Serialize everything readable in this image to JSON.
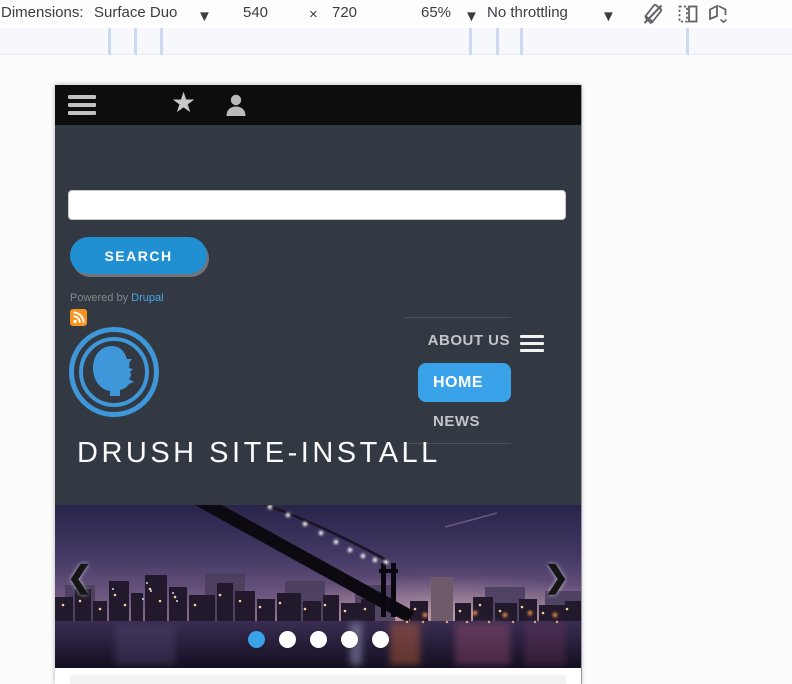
{
  "devtools_toolbar": {
    "dimensions_label": "Dimensions:",
    "device_name": "Surface Duo",
    "width_value": "540",
    "multiply_sign": "×",
    "height_value": "720",
    "zoom_value": "65%",
    "throttling_value": "No throttling",
    "caret": "▼",
    "icons": [
      "rotate-disabled",
      "dual-screen",
      "device-posture"
    ]
  },
  "admin_toolbar": {
    "icons": [
      "menu",
      "shortcuts-star",
      "user",
      "edit-pencil"
    ]
  },
  "search": {
    "value": "",
    "button_label": "SEARCH"
  },
  "branding": {
    "powered_prefix": "Powered by ",
    "powered_link": "Drupal",
    "site_name": "DRUSH SITE-INSTALL"
  },
  "nav": {
    "items": [
      {
        "label": "ABOUT US"
      },
      {
        "label": "HOME"
      },
      {
        "label": "NEWS"
      }
    ],
    "active_index": 1
  },
  "carousel": {
    "prev_arrow": "❮",
    "next_arrow": "❯",
    "dot_count": 5,
    "active_dot_index": 0
  },
  "colors": {
    "accent_blue": "#3aa2e8",
    "button_blue": "#2090d2",
    "link_blue": "#47aae2",
    "rss_orange": "#f8941d",
    "body_dark": "#333942",
    "toolbar_black": "#0d0d0d"
  }
}
